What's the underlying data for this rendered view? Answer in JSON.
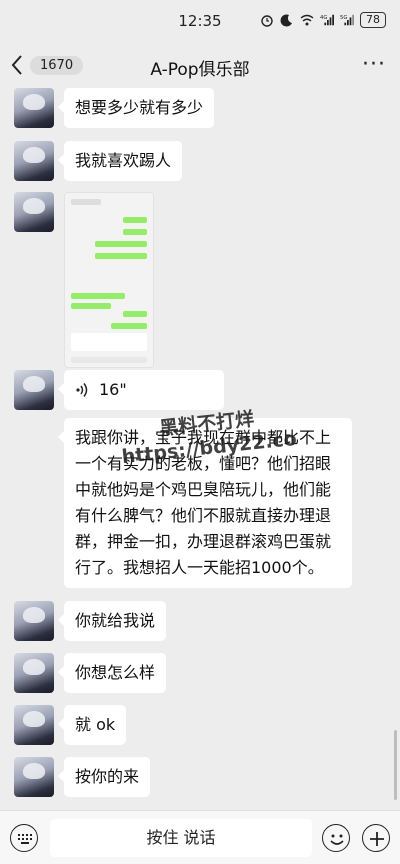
{
  "status_bar": {
    "time": "12:35",
    "battery": "78",
    "icons": [
      "alarm-icon",
      "moon-icon",
      "wifi-icon",
      "signal-4g-icon",
      "signal-5g-icon",
      "battery-icon"
    ]
  },
  "nav": {
    "badge": "1670",
    "title": "A-Pop俱乐部",
    "more": "···"
  },
  "messages": [
    {
      "type": "text",
      "text": "想要多少就有多少"
    },
    {
      "type": "text",
      "text": "我就喜欢踢人"
    },
    {
      "type": "image",
      "text": ""
    },
    {
      "type": "voice",
      "duration": "16\""
    },
    {
      "type": "text",
      "text": "我跟你讲，宝子我现在群中都比不上一个有实力的老板，懂吧？他们招眼中就他妈是个鸡巴臭陪玩儿，他们能有什么脾气？他们不服就直接办理退群，押金一扣，办理退群滚鸡巴蛋就行了。我想招人一天能招1000个。"
    },
    {
      "type": "text",
      "text": "你就给我说"
    },
    {
      "type": "text",
      "text": "你想怎么样"
    },
    {
      "type": "text",
      "text": "就 ok"
    },
    {
      "type": "text",
      "text": "按你的来"
    }
  ],
  "watermark": "黑料不打烊\nhttps://bdy22.co",
  "input_bar": {
    "hold_to_talk": "按住 说话"
  }
}
